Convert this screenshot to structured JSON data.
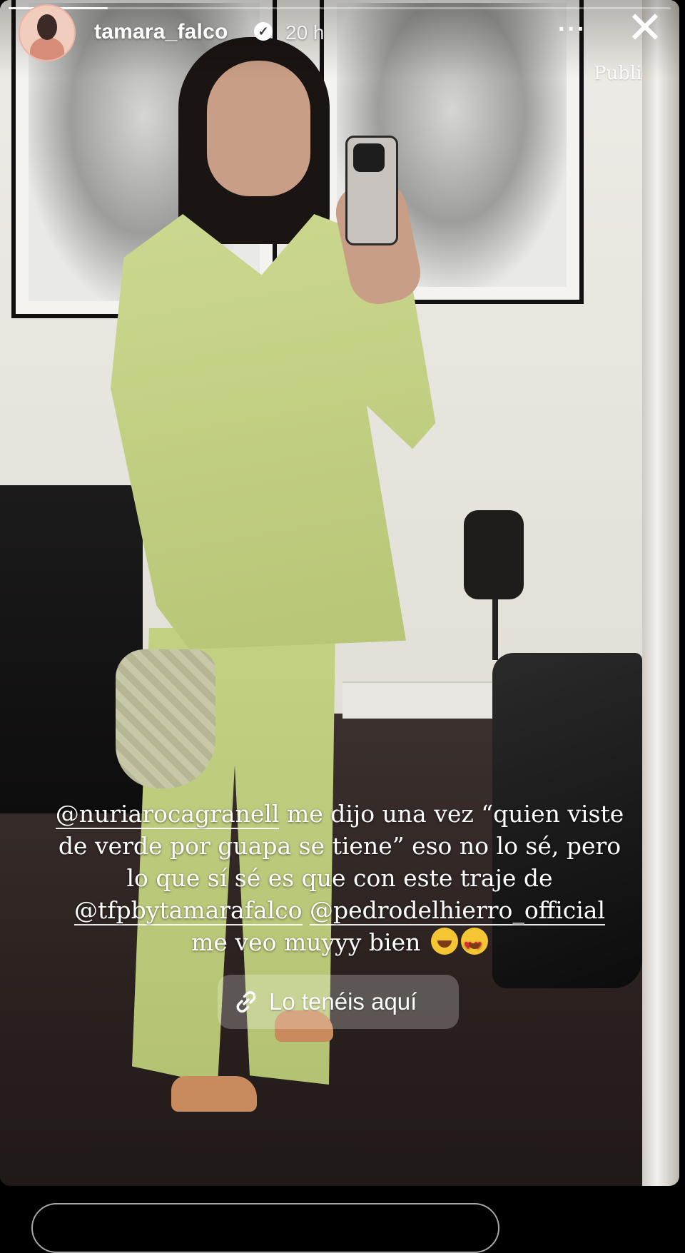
{
  "story": {
    "username": "tamara_falco",
    "verified_icon": "verified-badge-icon",
    "time": "20 h",
    "publi_label": "Publi",
    "more_label": "···",
    "close_label": "✕",
    "progress": 0.15
  },
  "caption": {
    "mention1": "@nuriarocagranell",
    "line1_rest": " me dijo una vez “quien viste",
    "line2": "de verde por guapa se tiene” eso no lo sé, pero",
    "line3": "lo que sí sé es que con este traje de",
    "mention2": "@tfpbytamarafalco",
    "mention3": "@pedrodelhierro_official",
    "line5": "me veo muyyy bien"
  },
  "link_sticker": {
    "label": "Lo tenéis aquí",
    "icon": "link-icon"
  },
  "colors": {
    "suit": "#c3d183",
    "sticker_bg": "rgba(255,255,255,0.24)",
    "text": "#ffffff"
  }
}
